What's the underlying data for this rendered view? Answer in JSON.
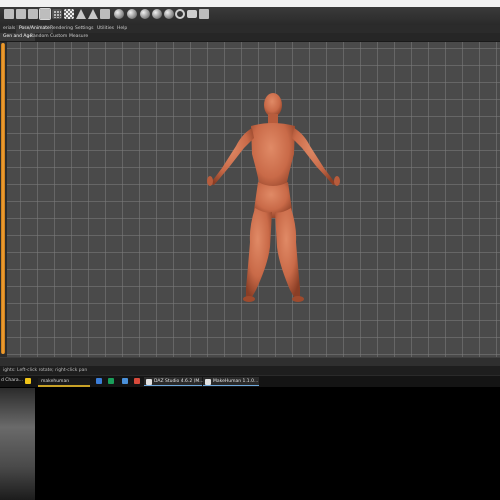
{
  "toolbar": {
    "icons": [
      "tool-icon",
      "tool-icon",
      "tool-icon",
      "tool-icon",
      "grid-icon",
      "checker-icon",
      "cone-icon",
      "cone-icon",
      "sphere-icon",
      "sphere-icon",
      "sphere-icon",
      "sphere-icon",
      "sphere-icon",
      "sphere-icon",
      "ring-icon",
      "camera-icon",
      "tool-icon"
    ]
  },
  "menu": {
    "tabs": [
      "erials",
      "Pose/Animate",
      "Rendering",
      "Settings",
      "Utilities",
      "Help"
    ],
    "active_index": 1
  },
  "submenu": {
    "tabs": [
      "Gen and Age",
      "Random",
      "Custom",
      "Measure"
    ],
    "active_index": 0
  },
  "status": {
    "text": "ights: Left-click rotate; right-click pan"
  },
  "taskbar": {
    "items": [
      {
        "label": "d Chara..."
      },
      {
        "label": "makehuman"
      },
      {
        "label": "DAZ Studio 4.6.2 (M..."
      },
      {
        "label": "MakeHuman 1.1.0..."
      }
    ]
  },
  "colors": {
    "accent": "#f5a33a",
    "viewport_bg": "#4a4a4a",
    "skin": "#c96a48"
  }
}
